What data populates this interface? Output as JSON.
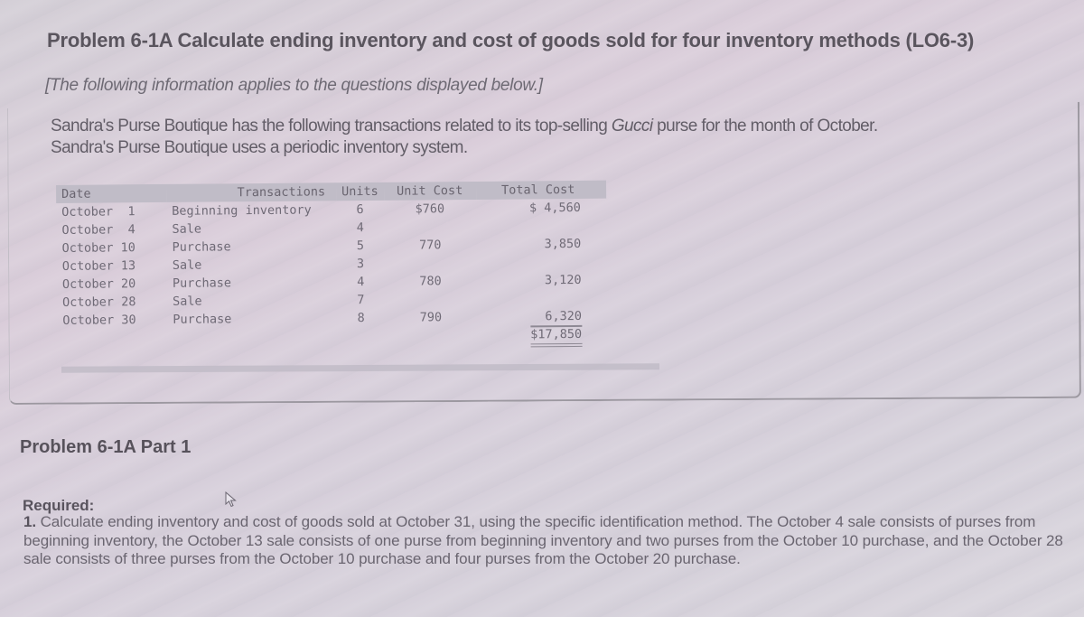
{
  "header": {
    "title": "Problem 6-1A Calculate ending inventory and cost of goods sold for four inventory methods (LO6-3)",
    "note": "[The following information applies to the questions displayed below.]"
  },
  "intro": {
    "line1_before": "Sandra's Purse Boutique has the following transactions related to its top-selling ",
    "brand": "Gucci",
    "line1_after": " purse for the month of October.",
    "line2": "Sandra's Purse Boutique uses a periodic inventory system."
  },
  "table": {
    "headers": {
      "date": "Date",
      "transactions": "Transactions",
      "units": "Units",
      "unit_cost": "Unit Cost",
      "total_cost": "Total Cost"
    },
    "rows": [
      {
        "date": "October  1",
        "transaction": "Beginning inventory",
        "units": "6",
        "unit_cost": "$760",
        "total_cost": "$ 4,560"
      },
      {
        "date": "October  4",
        "transaction": "Sale",
        "units": "4",
        "unit_cost": "",
        "total_cost": ""
      },
      {
        "date": "October 10",
        "transaction": "Purchase",
        "units": "5",
        "unit_cost": "770",
        "total_cost": "3,850"
      },
      {
        "date": "October 13",
        "transaction": "Sale",
        "units": "3",
        "unit_cost": "",
        "total_cost": ""
      },
      {
        "date": "October 20",
        "transaction": "Purchase",
        "units": "4",
        "unit_cost": "780",
        "total_cost": "3,120"
      },
      {
        "date": "October 28",
        "transaction": "Sale",
        "units": "7",
        "unit_cost": "",
        "total_cost": ""
      },
      {
        "date": "October 30",
        "transaction": "Purchase",
        "units": "8",
        "unit_cost": "790",
        "total_cost": "6,320"
      }
    ],
    "grand_total": "$17,850"
  },
  "part": {
    "title": "Problem 6-1A Part 1"
  },
  "required": {
    "label": "Required:",
    "number": "1.",
    "text": " Calculate ending inventory and cost of goods sold at October 31, using the specific identification method. The October 4 sale consists of purses from beginning inventory, the October 13 sale consists of one purse from beginning inventory and two purses from the October 10 purchase, and the October 28 sale consists of three purses from the October 10 purchase and four purses from the October 20 purchase."
  }
}
